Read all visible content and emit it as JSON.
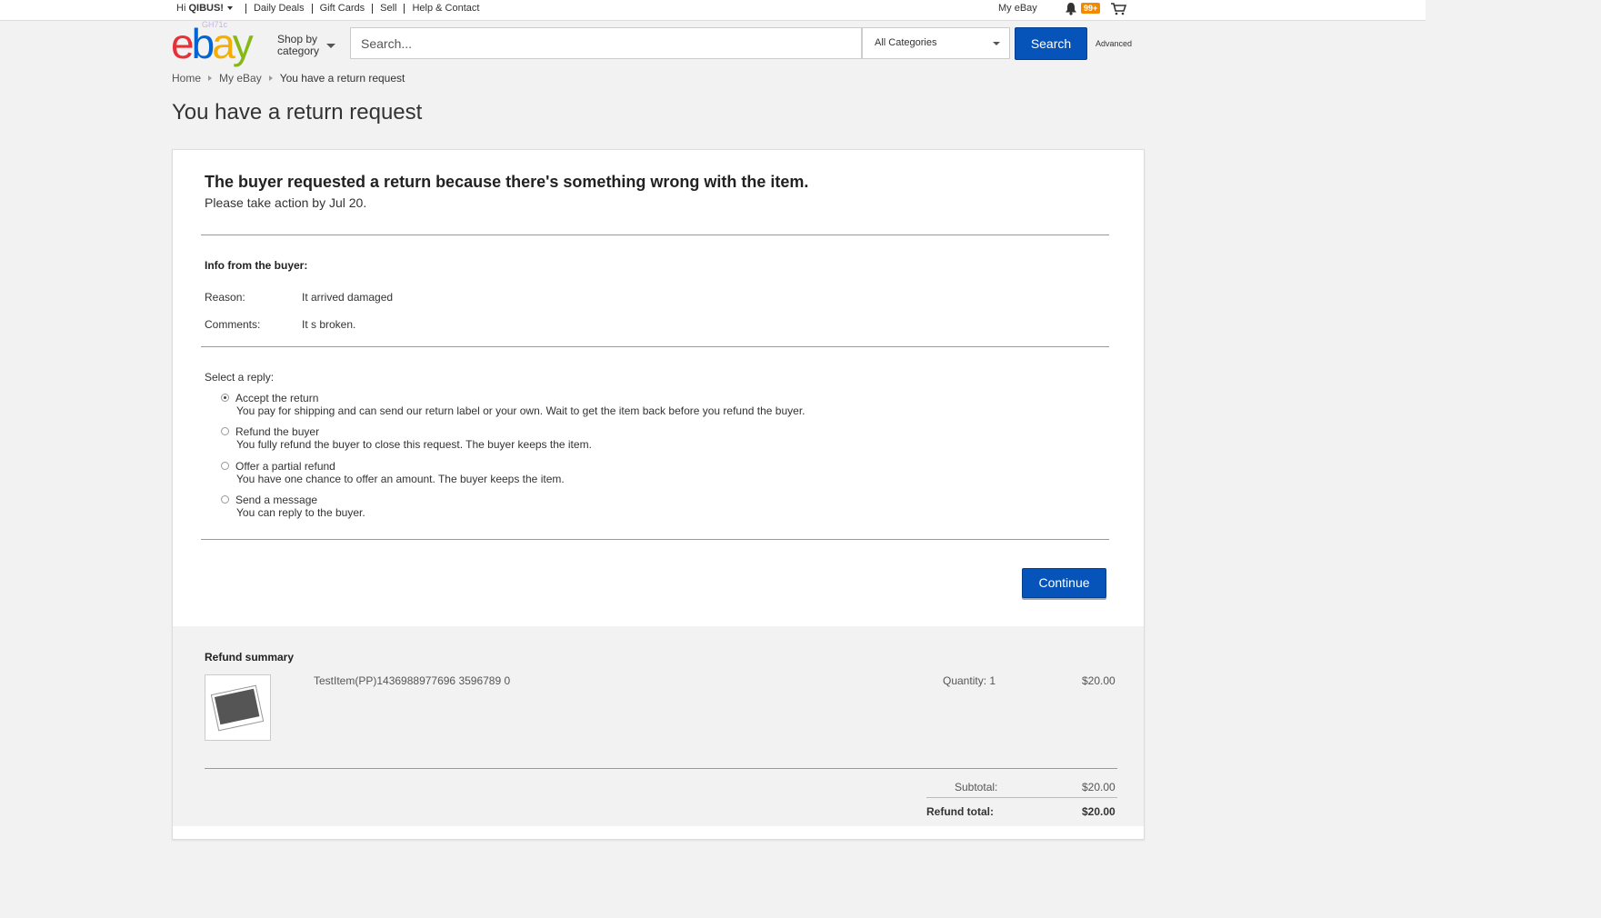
{
  "topnav": {
    "greeting_prefix": "Hi ",
    "user": "QIBUS!",
    "links": [
      "Daily Deals",
      "Gift Cards",
      "Sell",
      "Help & Contact"
    ],
    "my_ebay": "My eBay",
    "notifications_badge": "99+"
  },
  "header": {
    "logo": {
      "e": "e",
      "b": "b",
      "a": "a",
      "y": "y"
    },
    "logo_sub": "GH71c",
    "shop_by_line1": "Shop by",
    "shop_by_line2": "category",
    "search_placeholder": "Search...",
    "category_selected": "All Categories",
    "search_button": "Search",
    "advanced": "Advanced"
  },
  "breadcrumb": [
    "Home",
    "My eBay",
    "You have a return request"
  ],
  "page_title": "You have a return request",
  "request": {
    "heading": "The buyer requested a return because there's something wrong with the item.",
    "deadline": "Please take action by Jul 20.",
    "info_title": "Info from the buyer:",
    "reason_label": "Reason:",
    "reason_value": "It arrived damaged",
    "comments_label": "Comments:",
    "comments_value": "It s broken."
  },
  "reply": {
    "label": "Select a reply:",
    "options": [
      {
        "title": "Accept the return",
        "desc": "You pay for shipping and can send our return label or your own. Wait to get the item back before you refund the buyer.",
        "selected": true
      },
      {
        "title": "Refund the buyer",
        "desc": "You fully refund the buyer to close this request. The buyer keeps the item.",
        "selected": false
      },
      {
        "title": "Offer a partial refund",
        "desc": "You have one chance to offer an amount. The buyer keeps the item.",
        "selected": false
      },
      {
        "title": "Send a message",
        "desc": "You can reply to the buyer.",
        "selected": false
      }
    ],
    "continue_button": "Continue"
  },
  "refund_summary": {
    "title": "Refund summary",
    "item_title": "TestItem(PP)1436988977696 3596789 0",
    "quantity": "Quantity: 1",
    "price": "$20.00",
    "subtotal_label": "Subtotal:",
    "subtotal_value": "$20.00",
    "total_label": "Refund total:",
    "total_value": "$20.00"
  },
  "colors": {
    "primary_button": "#0654ba",
    "badge": "#f18c00"
  }
}
